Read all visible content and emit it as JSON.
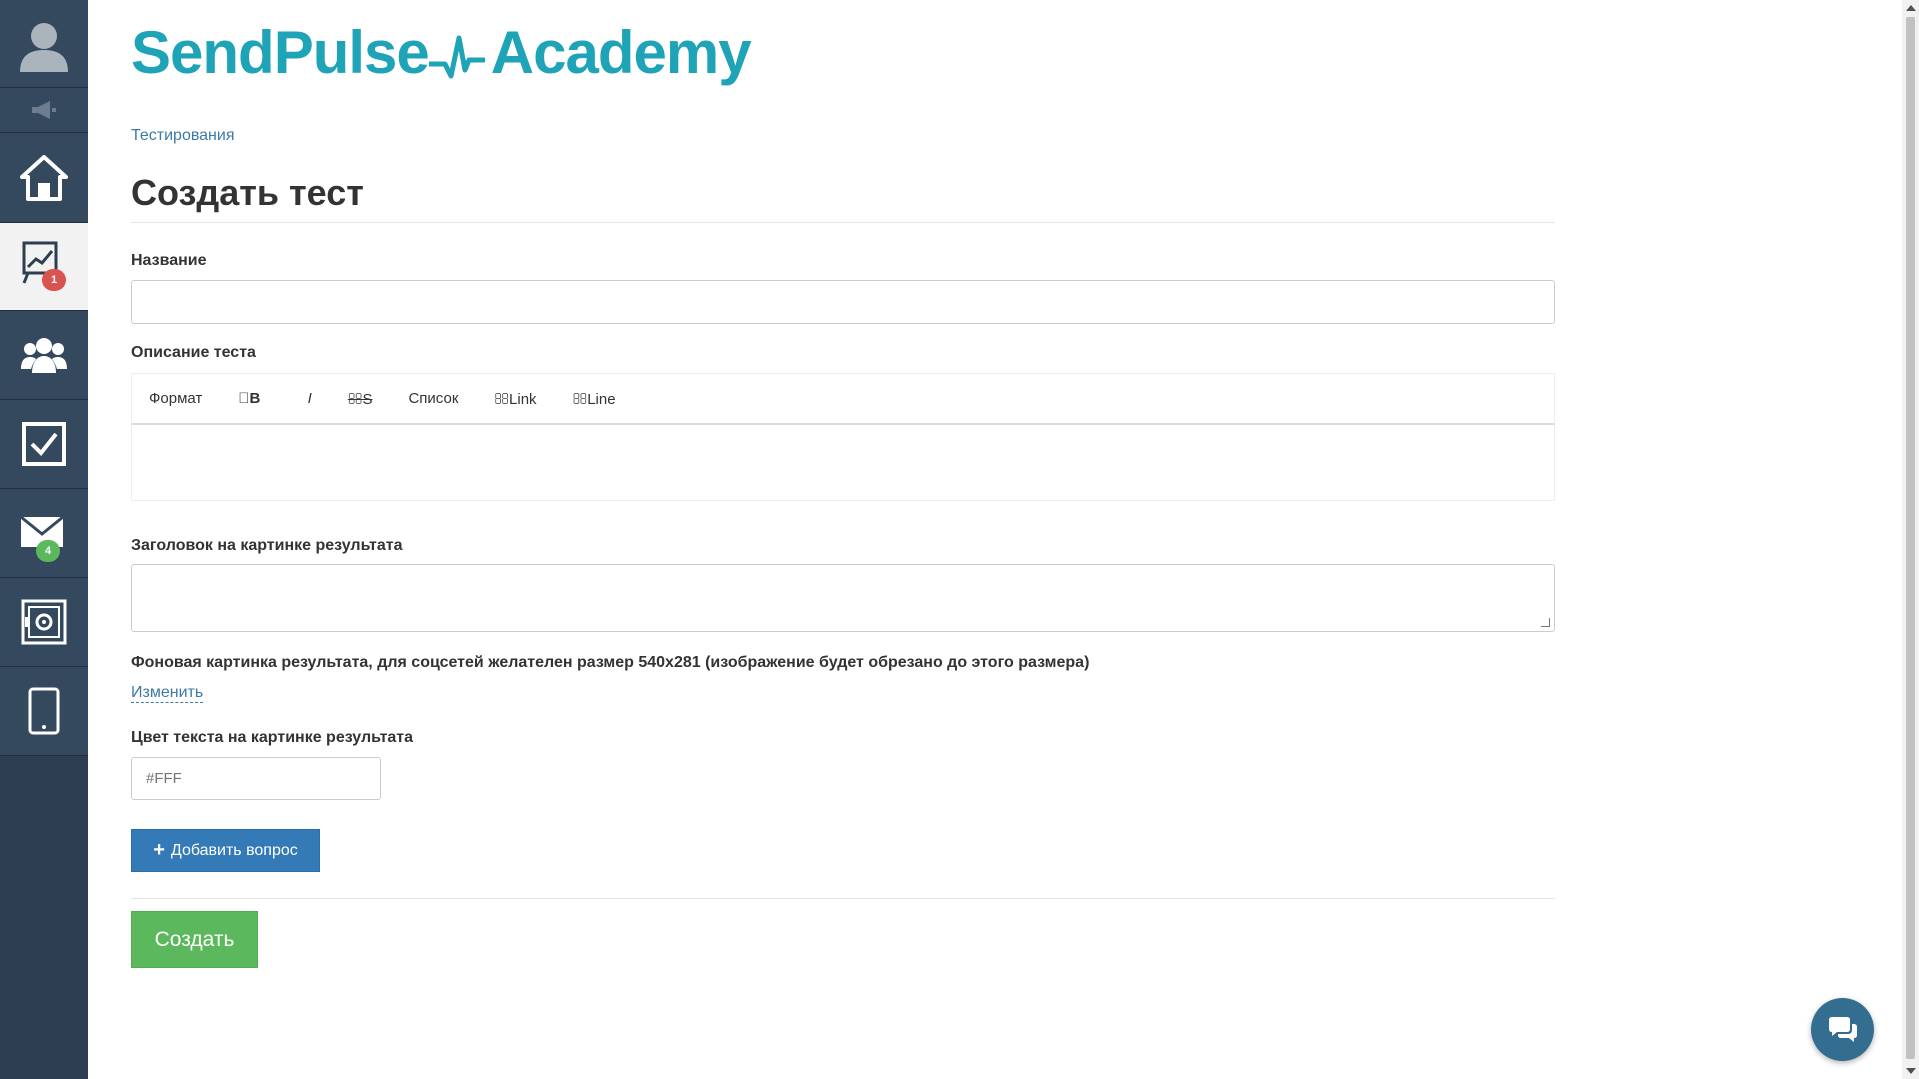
{
  "sidebar": {
    "items": [
      {
        "name": "avatar",
        "icon": "user-avatar-icon"
      },
      {
        "name": "mute",
        "icon": "megaphone-icon"
      },
      {
        "name": "home",
        "icon": "home-icon"
      },
      {
        "name": "statistics",
        "icon": "chart-line-icon",
        "badge": "1",
        "badge_color": "#d9534f",
        "active": true
      },
      {
        "name": "users",
        "icon": "users-group-icon"
      },
      {
        "name": "tasks",
        "icon": "checkbox-icon"
      },
      {
        "name": "mail",
        "icon": "envelope-icon",
        "badge": "4",
        "badge_color": "#5cb85c"
      },
      {
        "name": "safe",
        "icon": "safe-icon"
      },
      {
        "name": "mobile",
        "icon": "smartphone-icon"
      }
    ],
    "background": "#2c3e50"
  },
  "logo": {
    "part1": "SendPulse",
    "part2": "Academy",
    "color": "#1fa3b7"
  },
  "breadcrumb": {
    "text": "Тестирования"
  },
  "page": {
    "title": "Создать тест"
  },
  "form": {
    "name_label": "Название",
    "name_value": "",
    "description_label": "Описание теста",
    "toolbar": {
      "format": "Формат",
      "bold": "B",
      "italic": "I",
      "strike": "S",
      "list": "Список",
      "link": "Link",
      "line": "Line"
    },
    "result_title_label": "Заголовок на картинке результата",
    "result_bg_label": "Фоновая картинка результата, для соцсетей желателен размер 540x281 (изображение будет обрезано до этого размера)",
    "change_link": "Изменить",
    "text_color_label": "Цвет текста на картинке результата",
    "text_color_placeholder": "#FFF",
    "add_question_button": "Добавить вопрос",
    "create_button": "Создать"
  },
  "colors": {
    "primary": "#337ab7",
    "success": "#5cb85c",
    "link": "#3c7aa8",
    "chat": "#336e91"
  }
}
